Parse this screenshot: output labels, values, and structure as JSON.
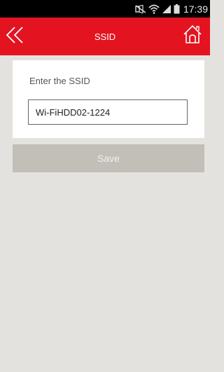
{
  "status_bar": {
    "time": "17:39",
    "icons": [
      "mute-icon",
      "wifi-icon",
      "signal-icon",
      "battery-icon"
    ]
  },
  "app_bar": {
    "title": "SSID",
    "back_icon": "double-chevron-left-icon",
    "home_icon": "home-icon",
    "color": "#e3141f"
  },
  "form": {
    "label": "Enter the SSID",
    "ssid_value": "Wi-FiHDD02-1224"
  },
  "actions": {
    "save_label": "Save",
    "save_color": "#c2beb8"
  },
  "colors": {
    "background": "#e4e2df",
    "card": "#ffffff"
  }
}
